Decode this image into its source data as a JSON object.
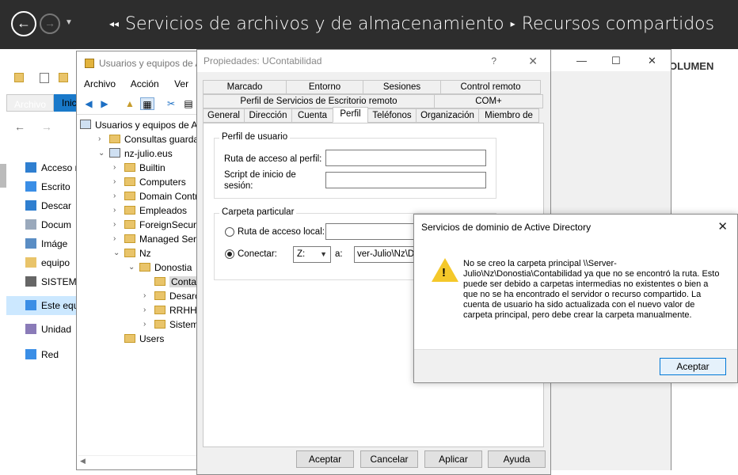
{
  "server_manager": {
    "breadcrumb_1": "Servicios de archivos y de almacenamiento",
    "breadcrumb_2": "Recursos compartidos",
    "tiles_label": "OLUMEN"
  },
  "explorer": {
    "ribbon_tab_active": "Archivo",
    "ribbon_tab_next": "Inic",
    "nav_items": [
      {
        "label": "Acceso r",
        "icon": "star-icon"
      },
      {
        "label": "Escrito",
        "icon": "desktop-icon"
      },
      {
        "label": "Descar",
        "icon": "download-icon"
      },
      {
        "label": "Docum",
        "icon": "documents-icon"
      },
      {
        "label": "Imáge",
        "icon": "pictures-icon"
      },
      {
        "label": "equipo",
        "icon": "folder-icon"
      },
      {
        "label": "SISTEM",
        "icon": "drive-icon"
      },
      {
        "label": "Este equ",
        "icon": "computer-icon"
      },
      {
        "label": "Unidad",
        "icon": "cd-icon"
      },
      {
        "label": "Red",
        "icon": "network-icon"
      }
    ]
  },
  "aduc": {
    "title": "Usuarios y equipos de A",
    "menu": [
      "Archivo",
      "Acción",
      "Ver"
    ],
    "tree": [
      {
        "label": "Usuarios y equipos de A",
        "level": 0,
        "expander": "",
        "icon": "console"
      },
      {
        "label": "Consultas guardadas",
        "level": 1,
        "expander": "›",
        "icon": "folder"
      },
      {
        "label": "nz-julio.eus",
        "level": 1,
        "expander": "⌄",
        "icon": "domain"
      },
      {
        "label": "Builtin",
        "level": 2,
        "expander": "›",
        "icon": "folder"
      },
      {
        "label": "Computers",
        "level": 2,
        "expander": "›",
        "icon": "folder"
      },
      {
        "label": "Domain Controll",
        "level": 2,
        "expander": "›",
        "icon": "folder"
      },
      {
        "label": "Empleados",
        "level": 2,
        "expander": "›",
        "icon": "folder"
      },
      {
        "label": "ForeignSecurityP",
        "level": 2,
        "expander": "›",
        "icon": "folder"
      },
      {
        "label": "Managed Service",
        "level": 2,
        "expander": "›",
        "icon": "folder"
      },
      {
        "label": "Nz",
        "level": 2,
        "expander": "⌄",
        "icon": "folder"
      },
      {
        "label": "Donostia",
        "level": 3,
        "expander": "⌄",
        "icon": "folder"
      },
      {
        "label": "Contabili",
        "level": 4,
        "expander": "",
        "icon": "folder",
        "selected": true
      },
      {
        "label": "Desarollo",
        "level": 4,
        "expander": "›",
        "icon": "folder"
      },
      {
        "label": "RRHH",
        "level": 4,
        "expander": "›",
        "icon": "folder"
      },
      {
        "label": "Sistemas",
        "level": 4,
        "expander": "›",
        "icon": "folder"
      },
      {
        "label": "Users",
        "level": 2,
        "expander": "",
        "icon": "folder"
      }
    ]
  },
  "properties": {
    "title": "Propiedades: UContabilidad",
    "help_glyph": "?",
    "tabs_row1": [
      "Marcado",
      "Entorno",
      "Sesiones",
      "Control remoto"
    ],
    "tabs_row2": [
      "Perfil de Servicios de Escritorio remoto",
      "COM+"
    ],
    "tabs_row3": [
      "General",
      "Dirección",
      "Cuenta",
      "Perfil",
      "Teléfonos",
      "Organización",
      "Miembro de"
    ],
    "active_tab": "Perfil",
    "profile_group": "Perfil de usuario",
    "profile_path_label": "Ruta de acceso al perfil:",
    "profile_path_value": "",
    "logon_script_label": "Script de inicio de sesión:",
    "logon_script_value": "",
    "home_group": "Carpeta particular",
    "local_path_label": "Ruta de acceso local:",
    "local_path_value": "",
    "connect_label": "Conectar:",
    "drive_value": "Z:",
    "to_label": "a:",
    "connect_path_value": "ver-Julio\\Nz\\Dono",
    "buttons": {
      "ok": "Aceptar",
      "cancel": "Cancelar",
      "apply": "Aplicar",
      "help": "Ayuda"
    }
  },
  "message_box": {
    "title": "Servicios de dominio de Active Directory",
    "message": "No se creo la carpeta principal \\\\Server-Julio\\Nz\\Donostia\\Contabilidad ya que no se encontró la ruta. Esto puede ser debido a carpetas intermedias no existentes o bien a que no se ha encontrado el servidor o recurso compartido. La cuenta de usuario ha sido actualizada con el nuevo valor de carpeta principal, pero debe crear la carpeta manualmente.",
    "ok_label": "Aceptar",
    "warning_color": "#f4c82a"
  }
}
